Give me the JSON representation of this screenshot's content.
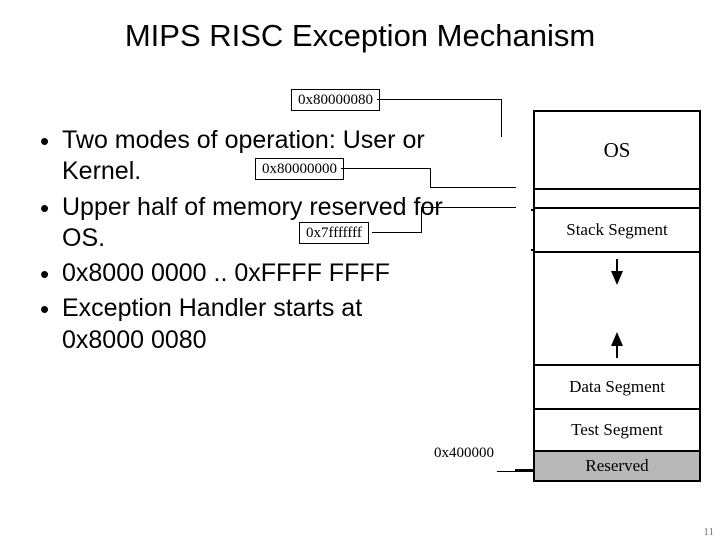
{
  "title": "MIPS RISC Exception Mechanism",
  "bullets": [
    "Two modes of operation: User or Kernel.",
    "Upper half of memory reserved for OS.",
    "0x8000 0000 .. 0xFFFF FFFF",
    "Exception Handler starts at 0x8000 0080"
  ],
  "addresses": {
    "exception_handler": "0x80000080",
    "kernel_base": "0x80000000",
    "user_top": "0x7fffffff",
    "text_base": "0x400000"
  },
  "memory_map": {
    "os": "OS",
    "stack": "Stack Segment",
    "data": "Data Segment",
    "text": "Test Segment",
    "reserved": "Reserved"
  },
  "page_number": "11"
}
